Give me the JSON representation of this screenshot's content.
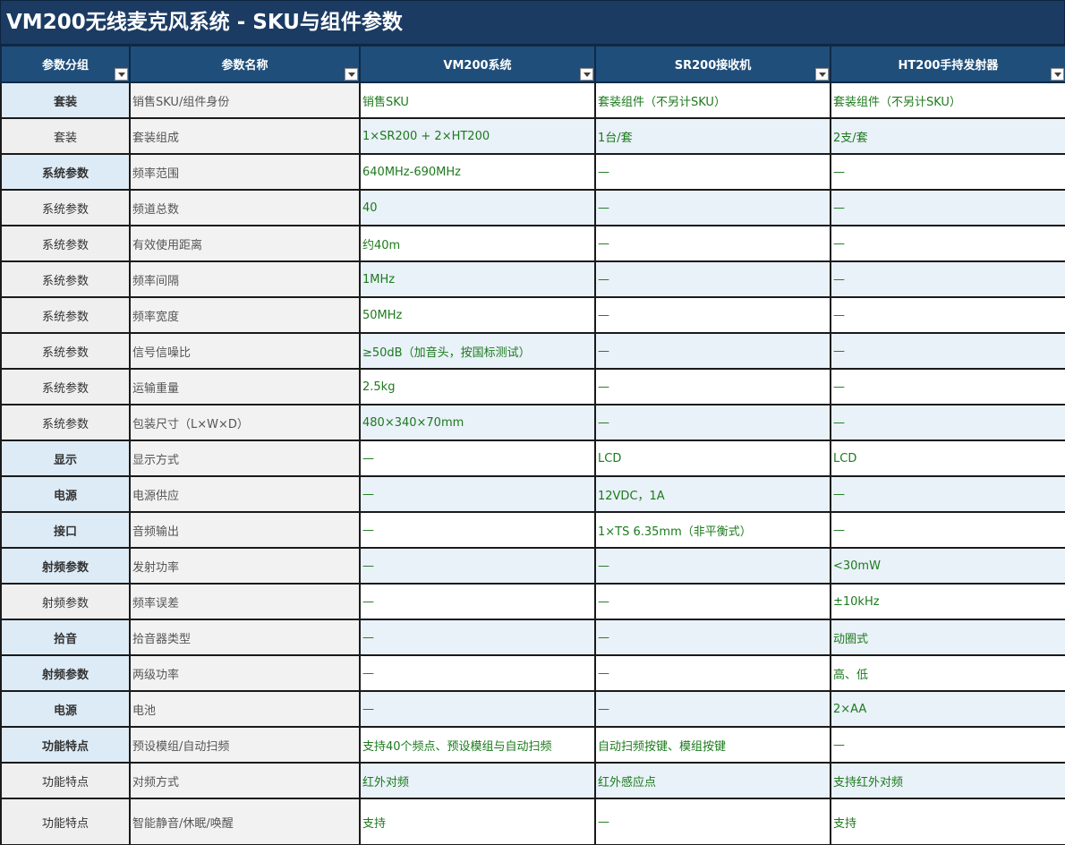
{
  "title": "VM200无线麦克风系统 - SKU与组件参数",
  "headers": [
    "参数分组",
    "参数名称",
    "VM200系统",
    "SR200接收机",
    "HT200手持发射器"
  ],
  "rows": [
    {
      "group": "套装",
      "name": "销售SKU/组件身份",
      "vm200": "销售SKU",
      "sr200": "套装组件（不另计SKU）",
      "ht200": "套装组件（不另计SKU）",
      "group_bold": true
    },
    {
      "group": "套装",
      "name": "套装组成",
      "vm200": "1×SR200 + 2×HT200",
      "sr200": "1台/套",
      "ht200": "2支/套",
      "group_bold": false
    },
    {
      "group": "系统参数",
      "name": "频率范围",
      "vm200": "640MHz-690MHz",
      "sr200": "—",
      "ht200": "—",
      "group_bold": true
    },
    {
      "group": "系统参数",
      "name": "频道总数",
      "vm200": "40",
      "sr200": "—",
      "ht200": "—",
      "group_bold": false
    },
    {
      "group": "系统参数",
      "name": "有效使用距离",
      "vm200": "约40m",
      "sr200": "—",
      "ht200": "—",
      "group_bold": false
    },
    {
      "group": "系统参数",
      "name": "频率间隔",
      "vm200": "1MHz",
      "sr200": "—",
      "ht200": "—",
      "group_bold": false
    },
    {
      "group": "系统参数",
      "name": "频率宽度",
      "vm200": "50MHz",
      "sr200": "—",
      "ht200": "—",
      "group_bold": false
    },
    {
      "group": "系统参数",
      "name": "信号信噪比",
      "vm200": "≥50dB（加音头，按国标测试）",
      "sr200": "—",
      "ht200": "—",
      "group_bold": false
    },
    {
      "group": "系统参数",
      "name": "运输重量",
      "vm200": "2.5kg",
      "sr200": "—",
      "ht200": "—",
      "group_bold": false
    },
    {
      "group": "系统参数",
      "name": "包装尺寸（L×W×D）",
      "vm200": "480×340×70mm",
      "sr200": "—",
      "ht200": "—",
      "group_bold": false
    },
    {
      "group": "显示",
      "name": "显示方式",
      "vm200": "—",
      "sr200": "LCD",
      "ht200": "LCD",
      "group_bold": true
    },
    {
      "group": "电源",
      "name": "电源供应",
      "vm200": "—",
      "sr200": "12VDC，1A",
      "ht200": "—",
      "group_bold": true
    },
    {
      "group": "接口",
      "name": "音频输出",
      "vm200": "—",
      "sr200": "1×TS 6.35mm（非平衡式）",
      "ht200": "—",
      "group_bold": true
    },
    {
      "group": "射频参数",
      "name": "发射功率",
      "vm200": "—",
      "sr200": "—",
      "ht200": "<30mW",
      "group_bold": true
    },
    {
      "group": "射频参数",
      "name": "频率误差",
      "vm200": "—",
      "sr200": "—",
      "ht200": "±10kHz",
      "group_bold": false
    },
    {
      "group": "拾音",
      "name": "拾音器类型",
      "vm200": "—",
      "sr200": "—",
      "ht200": "动圈式",
      "group_bold": true
    },
    {
      "group": "射频参数",
      "name": "两级功率",
      "vm200": "—",
      "sr200": "—",
      "ht200": "高、低",
      "group_bold": true
    },
    {
      "group": "电源",
      "name": "电池",
      "vm200": "—",
      "sr200": "—",
      "ht200": "2×AA",
      "group_bold": true
    },
    {
      "group": "功能特点",
      "name": "预设模组/自动扫频",
      "vm200": "支持40个频点、预设模组与自动扫频",
      "sr200": "自动扫频按键、模组按键",
      "ht200": "—",
      "group_bold": true
    },
    {
      "group": "功能特点",
      "name": "对频方式",
      "vm200": "红外对频",
      "sr200": "红外感应点",
      "ht200": "支持红外对频",
      "group_bold": false
    },
    {
      "group": "功能特点",
      "name": "智能静音/休眠/唤醒",
      "vm200": "支持",
      "sr200": "—",
      "ht200": "支持",
      "group_bold": false
    }
  ],
  "colors": {
    "title_bg": "#1b3b63",
    "header_bg": "#1f4e7a",
    "value_text": "#1c7a1c",
    "group_bold_bg": "#ddebf6",
    "row_tint_bg": "#e9f1f9"
  },
  "icons": {
    "filter": "dropdown-arrow-icon"
  }
}
